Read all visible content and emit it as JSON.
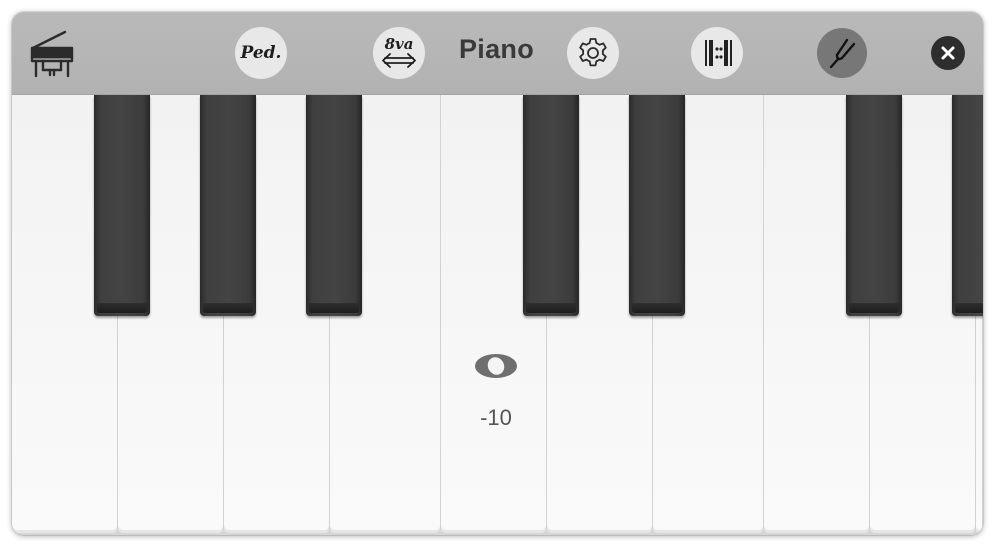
{
  "toolbar": {
    "title": "Piano",
    "pedal_label": "Ped.",
    "octave_label": "8va",
    "icons": {
      "instrument": "grand-piano-icon",
      "pedal": "sustain-pedal-icon",
      "octave": "octave-shift-icon",
      "settings": "gear-icon",
      "repeat": "repeat-bar-icon",
      "tuning": "tuning-fork-icon",
      "close": "close-icon"
    }
  },
  "keyboard": {
    "white_key_count": 9,
    "black_key_count": 7,
    "pitch_offset": "-10",
    "pitch_indicator_icon": "pitch-ring-icon"
  },
  "colors": {
    "toolbar": "#b5b5b5",
    "button": "#e8e8e8",
    "active_button": "#777777",
    "black_key": "#404040",
    "white_key": "#f6f6f6"
  }
}
